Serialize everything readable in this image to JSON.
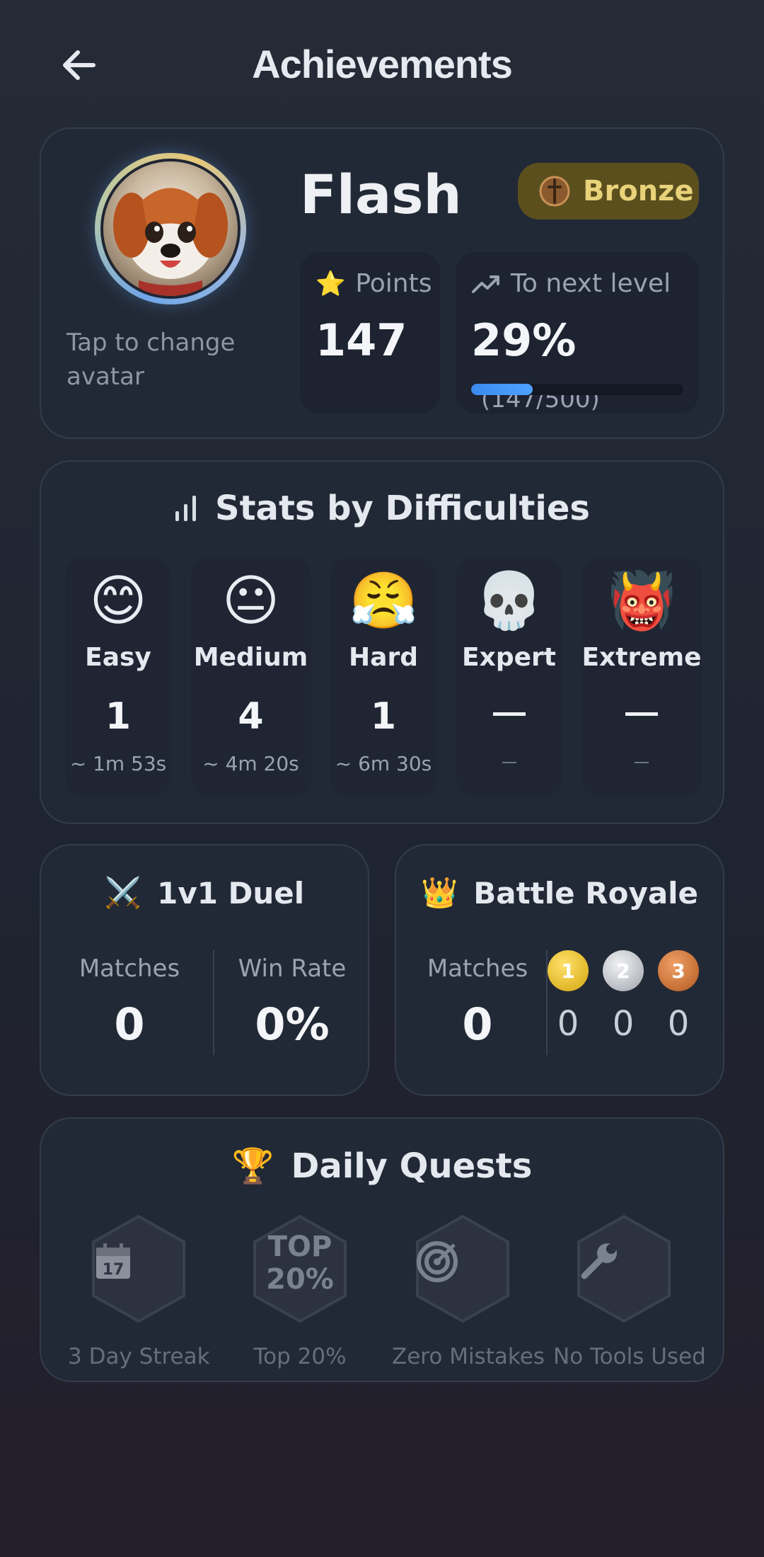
{
  "header": {
    "title": "Achievements"
  },
  "profile": {
    "name": "Flash",
    "avatar_hint": "Tap to change avatar",
    "rank": "Bronze",
    "points_label": "Points",
    "points": "147",
    "next_level_label": "To next level",
    "next_level_percent": "29%",
    "next_level_detail": "(147/500)",
    "progress_fraction": 0.29
  },
  "difficulties": {
    "title": "Stats by Difficulties",
    "items": [
      {
        "emoji": "😊",
        "name": "Easy",
        "count": "1",
        "avg": "~ 1m 53s"
      },
      {
        "emoji": "😐",
        "name": "Medium",
        "count": "4",
        "avg": "~ 4m 20s"
      },
      {
        "emoji": "😤",
        "name": "Hard",
        "count": "1",
        "avg": "~ 6m 30s"
      },
      {
        "emoji": "💀",
        "name": "Expert",
        "count": null,
        "avg": null
      },
      {
        "emoji": "👹",
        "name": "Extreme",
        "count": null,
        "avg": null
      }
    ]
  },
  "duel": {
    "icon": "⚔️",
    "title": "1v1 Duel",
    "matches_label": "Matches",
    "matches": "0",
    "winrate_label": "Win Rate",
    "winrate": "0%"
  },
  "royale": {
    "icon": "👑",
    "title": "Battle Royale",
    "matches_label": "Matches",
    "matches": "0",
    "gold": "0",
    "silver": "0",
    "bronze": "0"
  },
  "quests": {
    "icon": "🏆",
    "title": "Daily Quests",
    "items": [
      {
        "label": "3 Day Streak",
        "icon": "calendar-icon"
      },
      {
        "label": "Top 20%",
        "icon": "top-percent-icon",
        "glyph_top": "TOP",
        "glyph_bottom": "20%"
      },
      {
        "label": "Zero Mistakes",
        "icon": "target-icon"
      },
      {
        "label": "No Tools Used",
        "icon": "wrench-icon"
      }
    ]
  },
  "colors": {
    "accent": "#4a96f6",
    "rank_bg": "#5b4f1e",
    "rank_text": "#e8d27a"
  }
}
